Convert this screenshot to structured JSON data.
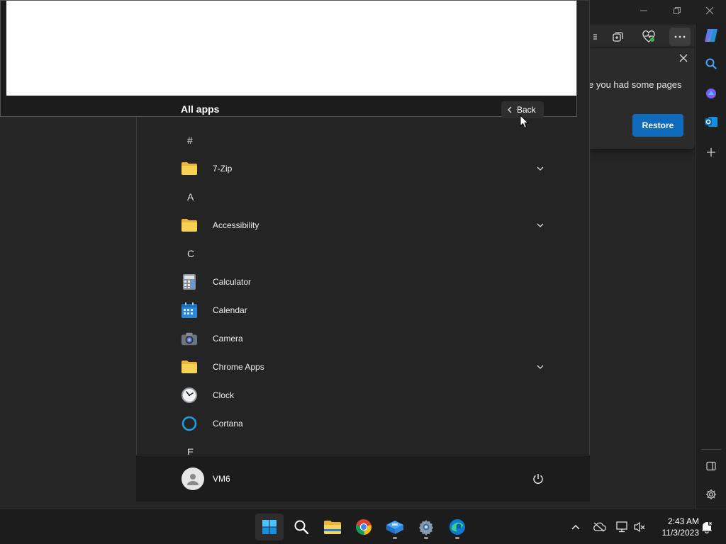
{
  "start_menu": {
    "header": {
      "title": "All apps",
      "back_label": "Back"
    },
    "groups": [
      {
        "letter": "#",
        "apps": [
          {
            "label": "7-Zip",
            "icon": "folder-icon",
            "expandable": true
          }
        ]
      },
      {
        "letter": "A",
        "apps": [
          {
            "label": "Accessibility",
            "icon": "folder-icon",
            "expandable": true
          }
        ]
      },
      {
        "letter": "C",
        "apps": [
          {
            "label": "Calculator",
            "icon": "calculator-icon",
            "expandable": false
          },
          {
            "label": "Calendar",
            "icon": "calendar-icon",
            "expandable": false
          },
          {
            "label": "Camera",
            "icon": "camera-icon",
            "expandable": false
          },
          {
            "label": "Chrome Apps",
            "icon": "folder-icon",
            "expandable": true
          },
          {
            "label": "Clock",
            "icon": "clock-icon",
            "expandable": false
          },
          {
            "label": "Cortana",
            "icon": "cortana-icon",
            "expandable": false
          }
        ]
      },
      {
        "letter": "E",
        "apps": []
      }
    ],
    "footer": {
      "user_name": "VM6"
    }
  },
  "browser": {
    "restore_prompt": {
      "text": "e you had some pages",
      "button_label": "Restore"
    }
  },
  "taskbar": {
    "apps": [
      "start-icon",
      "search-icon",
      "file-explorer-icon",
      "chrome-icon",
      "windows-sandbox-icon",
      "settings-icon",
      "edge-icon"
    ],
    "clock": {
      "time": "2:43 AM",
      "date": "11/3/2023"
    }
  },
  "colors": {
    "accent_blue": "#0f6cbd",
    "folder_yellow": "#f6c944",
    "menu_background": "#242424"
  }
}
